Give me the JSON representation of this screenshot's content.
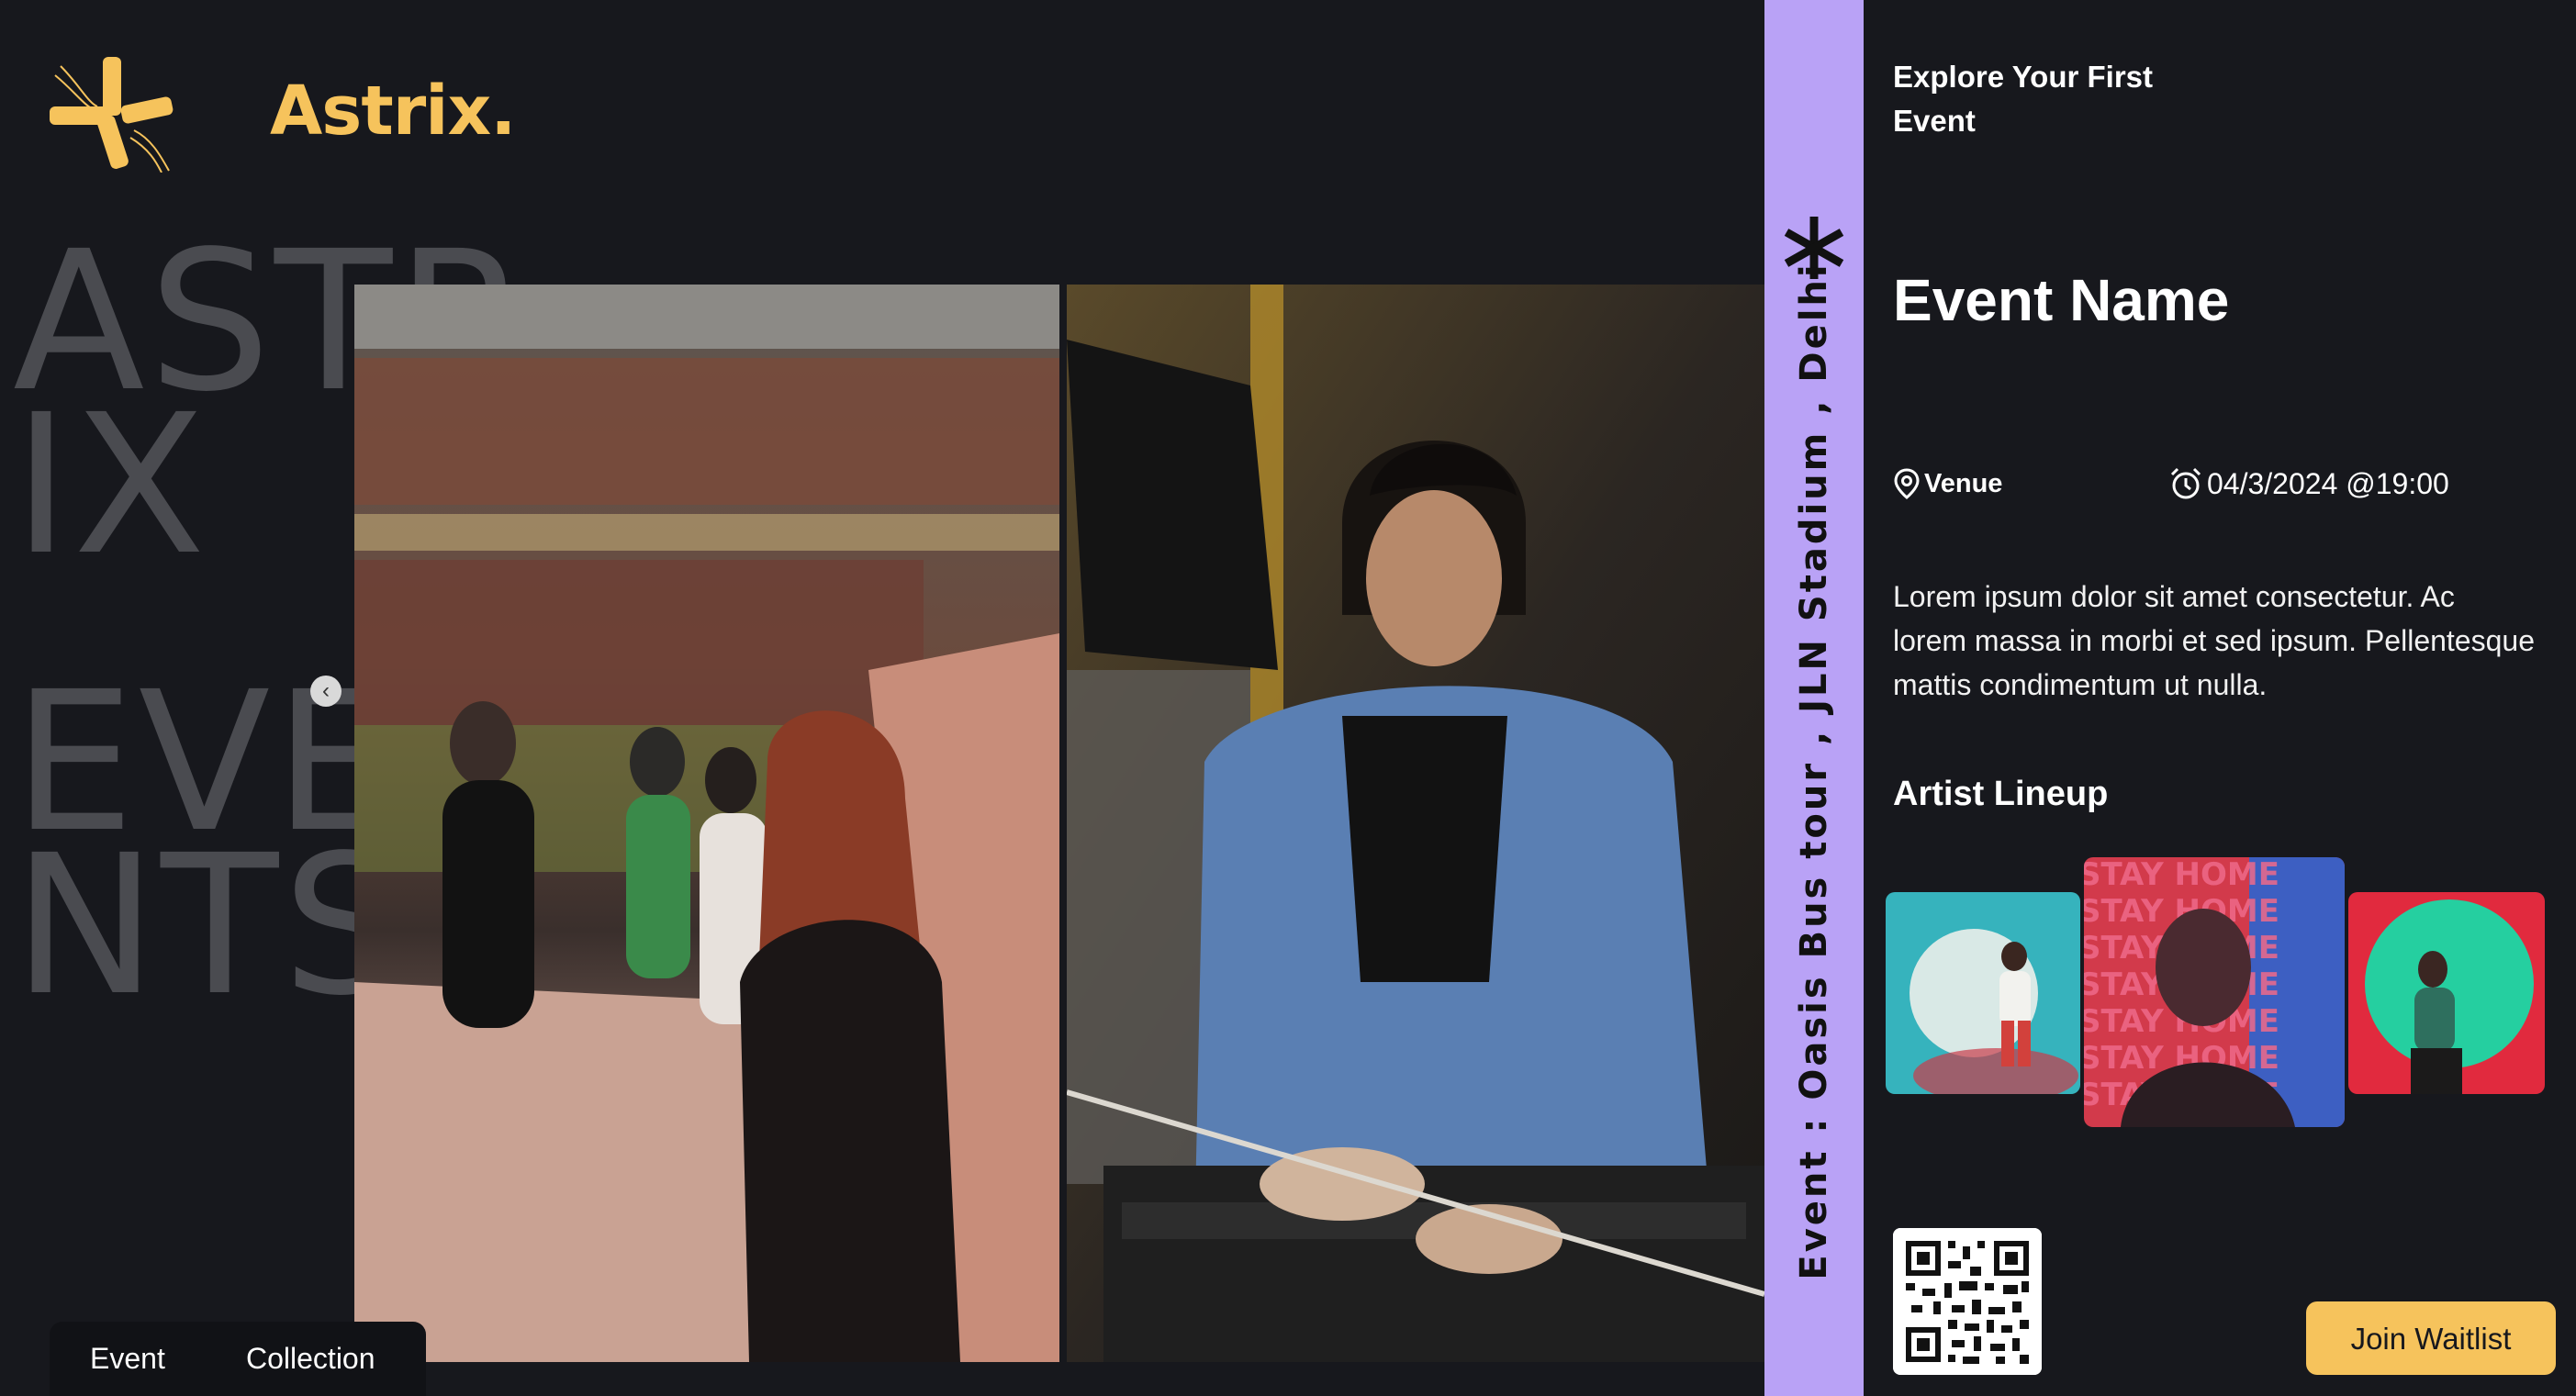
{
  "brand": {
    "name": "Astrix."
  },
  "background_text": {
    "line1": "ASTR\nIX",
    "line2": "EVE\nNTS"
  },
  "bottom_nav": {
    "items": [
      "Event",
      "Collection"
    ]
  },
  "strip": {
    "text": "Event : Oasis Bus tour , JLN Stadium , Delhi"
  },
  "event": {
    "explore_title": "Explore Your First Event",
    "name": "Event Name",
    "venue": "Venue",
    "datetime": "04/3/2024 @19:00",
    "description": "Lorem ipsum dolor sit amet consectetur. Ac lorem massa in morbi et sed ipsum. Pellentesque mattis condimentum ut nulla.",
    "lineup_title": "Artist Lineup",
    "artist_2_poster_text": "STAY HOME"
  },
  "join_button": {
    "label": "Join Waitlist"
  },
  "colors": {
    "accent": "#f6c35c",
    "strip": "#b9a2f6",
    "background": "#17181d"
  },
  "icons": [
    "logo-mark-icon",
    "chevron-left-icon",
    "asterisk-icon",
    "location-pin-icon",
    "alarm-clock-icon",
    "qr-code"
  ]
}
